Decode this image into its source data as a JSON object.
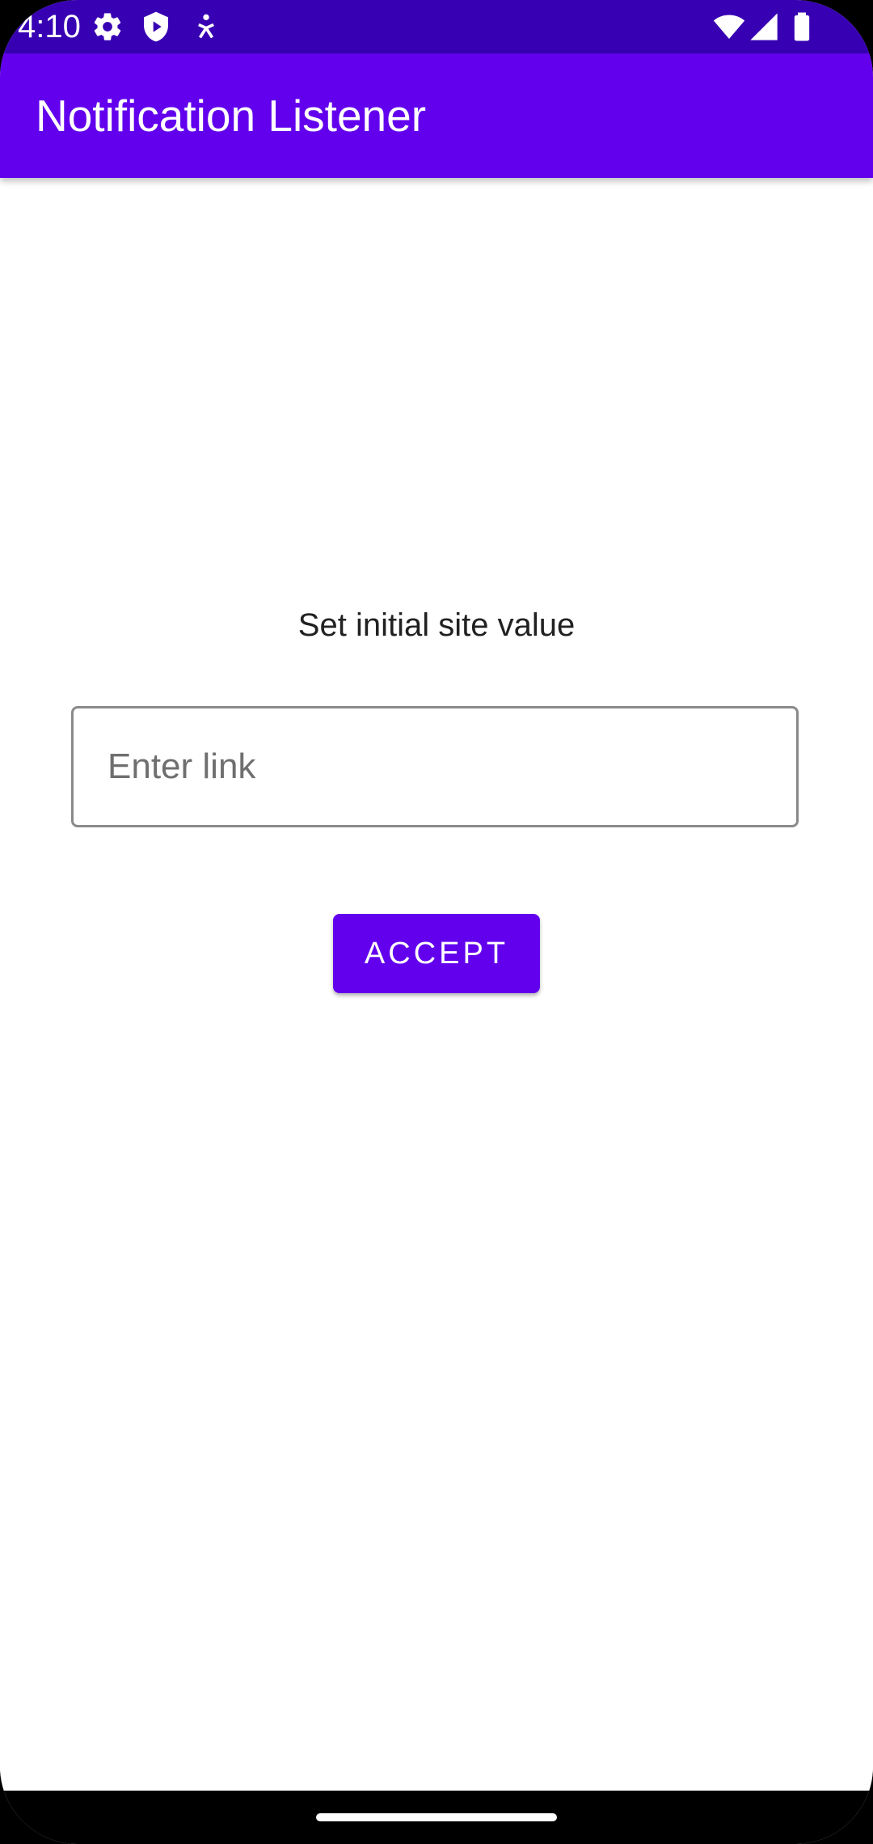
{
  "status_bar": {
    "time": "4:10",
    "left_icons": [
      "gear-icon",
      "shield-play-icon",
      "accessibility-icon"
    ],
    "right_icons": [
      "wifi-icon",
      "cellular-signal-icon",
      "battery-icon"
    ]
  },
  "app_bar": {
    "title": "Notification Listener"
  },
  "main": {
    "prompt": "Set initial site value",
    "link_input": {
      "placeholder": "Enter link",
      "value": ""
    },
    "accept_label": "ACCEPT"
  },
  "colors": {
    "status_bar": "#3700b3",
    "primary": "#6200ee",
    "background": "#ffffff",
    "nav_bar": "#000000"
  }
}
